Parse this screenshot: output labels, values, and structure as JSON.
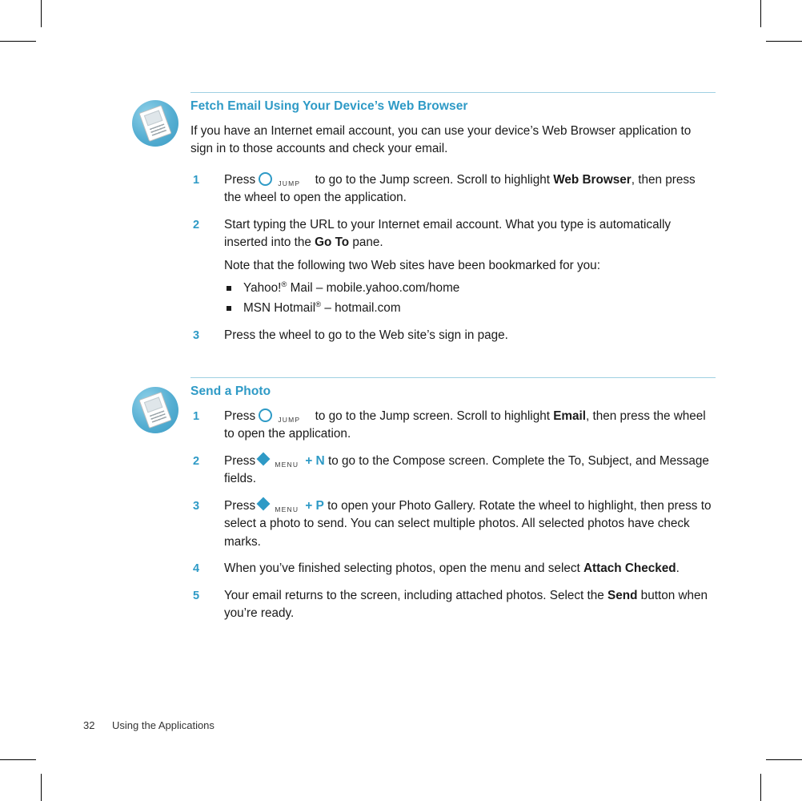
{
  "page": {
    "number": "32",
    "footer_title": "Using the Applications"
  },
  "colors": {
    "accent": "#2e9ac6",
    "rule": "#9fd0e2",
    "text": "#1a1a1a"
  },
  "sections": [
    {
      "id": "fetch-email",
      "title": "Fetch Email Using Your Device’s Web Browser",
      "intro": "If you have an Internet email account, you can use your device’s Web Browser application to sign in to those accounts and check your email.",
      "steps": [
        {
          "num": "1",
          "pre": "Press",
          "key": "JUMP",
          "post_a": " to go to the Jump screen. Scroll to highlight ",
          "bold": "Web Browser",
          "post_b": ", then press the wheel to open the application."
        },
        {
          "num": "2",
          "pre": "Start typing the URL to your Internet email account. What you type is automatically inserted into the ",
          "bold": "Go To",
          "post_b": " pane.",
          "note": "Note that the following two Web sites have been bookmarked for you:",
          "bullets": [
            {
              "name": "Yahoo!",
              "reg": "®",
              "after": " Mail",
              "dash": "– mobile.yahoo.com/home"
            },
            {
              "name": "MSN Hotmail",
              "reg": "®",
              "after": "",
              "dash": "– hotmail.com"
            }
          ]
        },
        {
          "num": "3",
          "pre": "Press the wheel to go to the Web site’s sign in page."
        }
      ]
    },
    {
      "id": "send-a-photo",
      "title": "Send a Photo",
      "steps": [
        {
          "num": "1",
          "pre": "Press",
          "key": "JUMP",
          "post_a": " to go to the Jump screen. Scroll to highlight ",
          "bold": "Email",
          "post_b": ", then press the wheel to open the application."
        },
        {
          "num": "2",
          "pre": "Press",
          "key": "MENU",
          "plus": "+",
          "letter": "N",
          "post_b": " to go to the Compose screen. Complete the To, Subject, and Message fields."
        },
        {
          "num": "3",
          "pre": "Press",
          "key": "MENU",
          "plus": "+",
          "letter": "P",
          "post_b": " to open your Photo Gallery. Rotate the wheel to highlight, then press to select a photo to send. You can select multiple photos. All selected photos have check marks."
        },
        {
          "num": "4",
          "pre": "When you’ve finished selecting photos, open the menu and select ",
          "bold": "Attach Checked",
          "post_b": "."
        },
        {
          "num": "5",
          "pre": "Your email returns to the screen, including attached photos. Select the ",
          "bold": "Send",
          "post_b": " button when you’re ready."
        }
      ]
    }
  ]
}
